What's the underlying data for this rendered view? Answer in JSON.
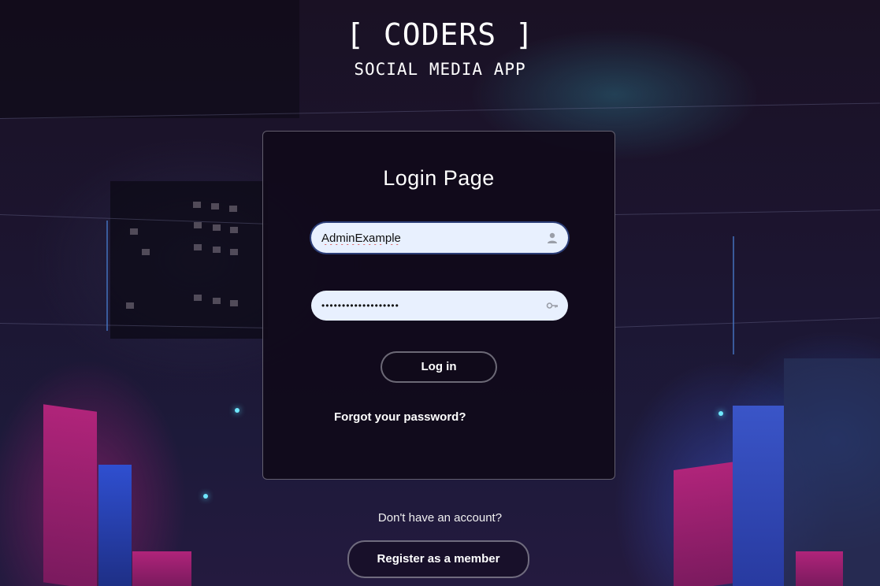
{
  "brand": {
    "title": "[ CODERS ]",
    "subtitle": "SOCIAL MEDIA APP"
  },
  "login_card": {
    "title": "Login Page",
    "username": {
      "value": "AdminExample",
      "icon": "user-icon"
    },
    "password": {
      "value": "•••••••••••••••••••",
      "icon": "key-icon"
    },
    "login_label": "Log in",
    "forgot_label": "Forgot your password?"
  },
  "register": {
    "prompt": "Don't have an account?",
    "button_label": "Register as a member"
  },
  "colors": {
    "input_bg": "#e8f0fe",
    "card_bg": "#100a1a",
    "text": "#ffffff"
  }
}
